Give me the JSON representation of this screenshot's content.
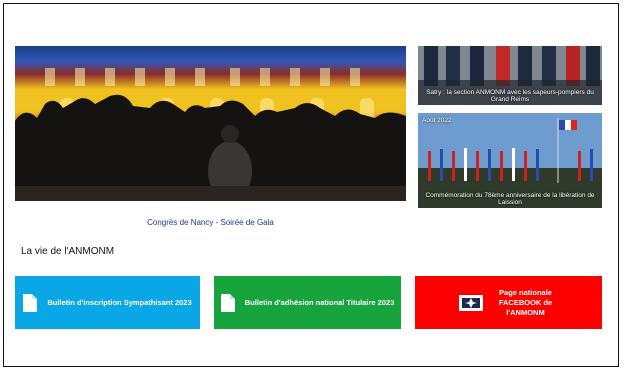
{
  "hero": {
    "caption": "Congrès de Nancy - Soirée de Gala"
  },
  "news": [
    {
      "date": "",
      "caption": "Satry : la section ANMONM avec les sapeurs-pompiers du Grand Reims"
    },
    {
      "date": "Août 2022",
      "caption": "Commémoration du 78ème anniversaire de la libération de Laission"
    }
  ],
  "section": {
    "title": "La vie de l'ANMONM"
  },
  "tiles": [
    {
      "label": "Bulletin d'inscription Sympathisant 2023",
      "icon": "document-icon",
      "color": "#0aa7e6"
    },
    {
      "label": "Bulletin d'adhésion national Titulaire 2023",
      "icon": "document-icon",
      "color": "#18a43c"
    },
    {
      "label": "Page nationale FACEBOOK de l'ANMONM",
      "icon": "medal-emblem-icon",
      "color": "#ff0000"
    }
  ]
}
